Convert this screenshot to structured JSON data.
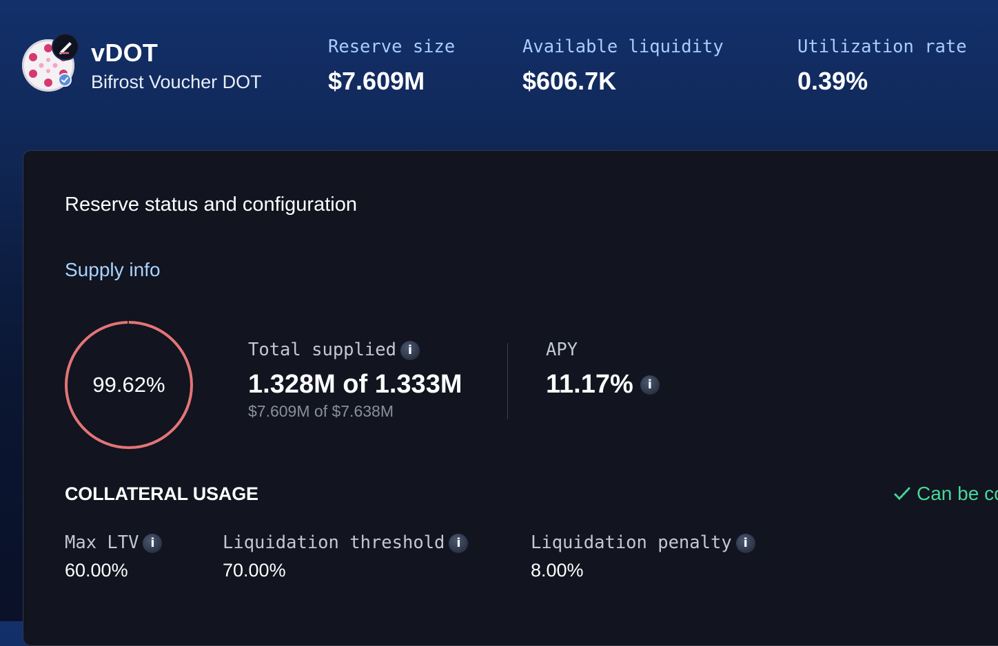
{
  "asset": {
    "symbol": "vDOT",
    "name": "Bifrost Voucher DOT",
    "logo_icon": "vdot-coin-icon",
    "chain_badge_icon": "chain-badge-icon",
    "verified_icon": "verified-badge-icon"
  },
  "header_stats": [
    {
      "label": "Reserve size",
      "value": "$7.609M"
    },
    {
      "label": "Available liquidity",
      "value": "$606.7K"
    },
    {
      "label": "Utilization rate",
      "value": "0.39%"
    }
  ],
  "card": {
    "title": "Reserve status and configuration"
  },
  "supply_info": {
    "section_title": "Supply info",
    "ring_percent_text": "99.62%",
    "ring_fraction": 0.9962,
    "total_supplied_label": "Total supplied",
    "total_supplied_value": "1.328M of 1.333M",
    "total_supplied_usd": "$7.609M of $7.638M",
    "apy_label": "APY",
    "apy_value": "11.17%",
    "info_glyph": "i"
  },
  "collateral": {
    "title": "COLLATERAL USAGE",
    "status_text": "Can be co",
    "status_icon": "check-icon",
    "params": [
      {
        "label": "Max LTV",
        "value": "60.00%"
      },
      {
        "label": "Liquidation threshold",
        "value": "70.00%"
      },
      {
        "label": "Liquidation penalty",
        "value": "8.00%"
      }
    ]
  },
  "colors": {
    "accent_blue": "#a8cdfb",
    "ring": "#e37575",
    "success": "#46d89a",
    "card_bg": "#121420"
  }
}
